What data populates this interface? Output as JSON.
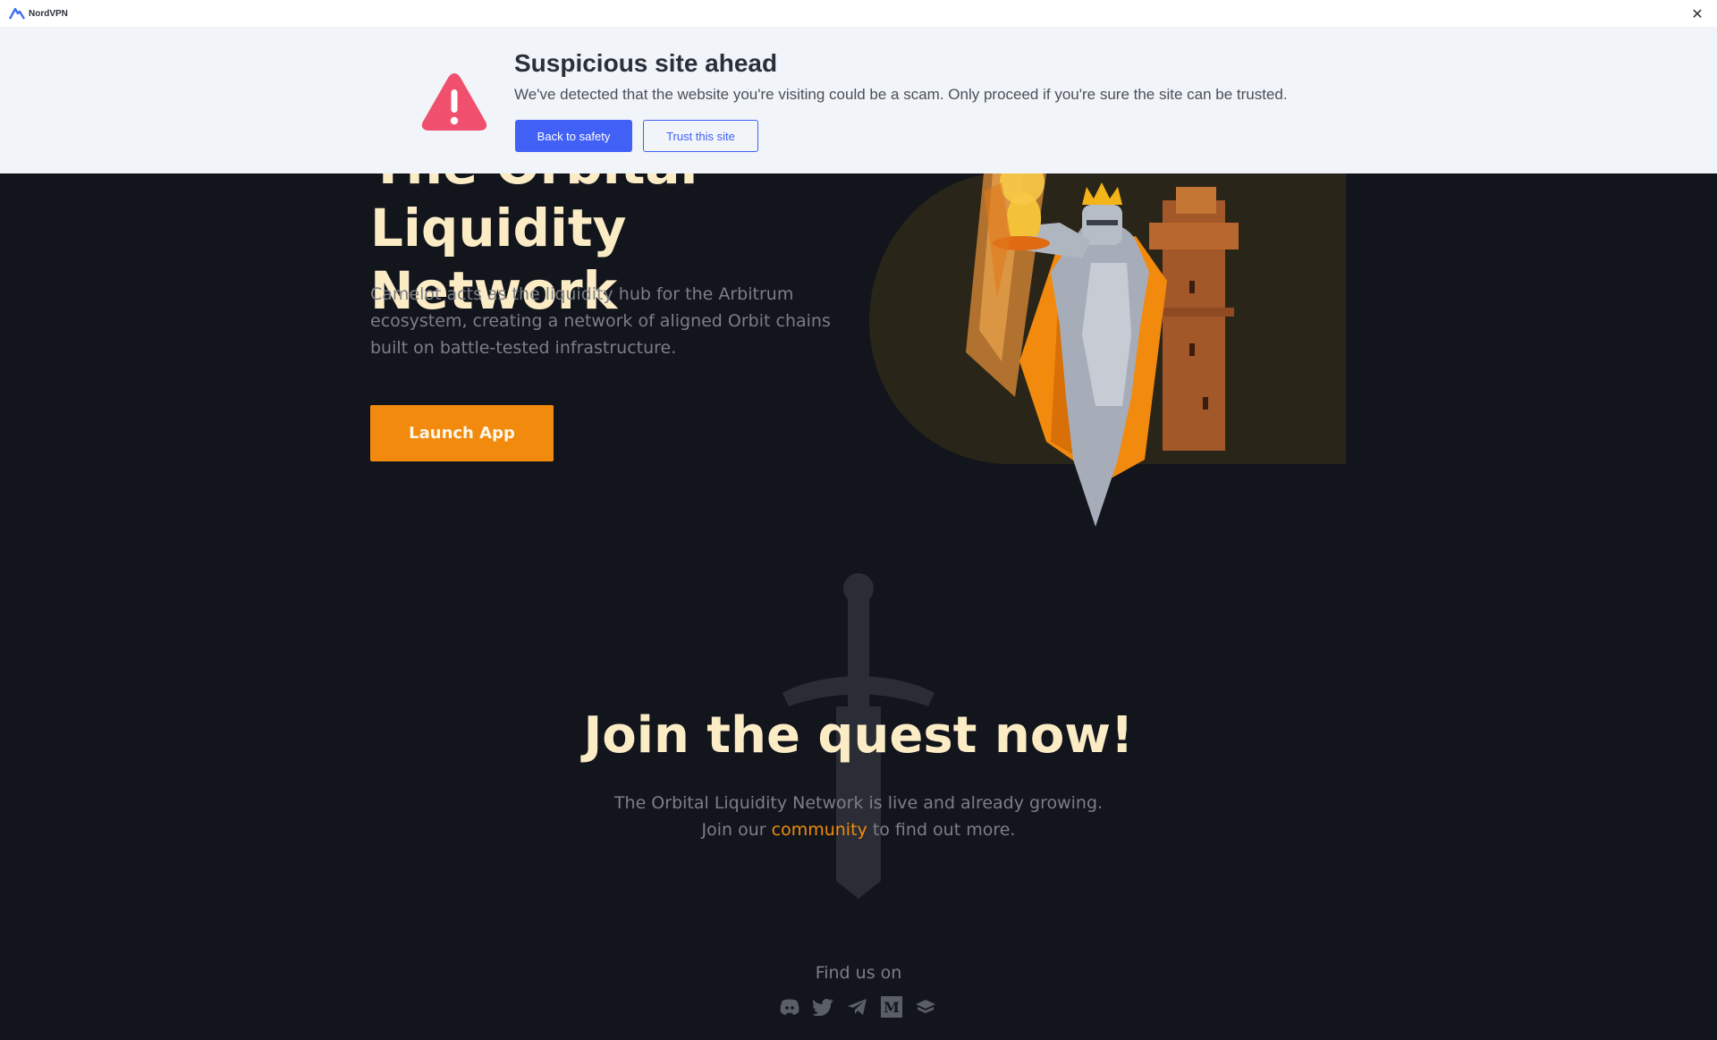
{
  "nordvpn": {
    "brand": "NordVPN",
    "close_glyph": "✕"
  },
  "warning": {
    "title": "Suspicious site ahead",
    "description": "We've detected that the website you're visiting could be a scam. Only proceed if you're sure the site can be trusted.",
    "back_button": "Back to safety",
    "trust_button": "Trust this site",
    "icon": "warning-triangle-icon",
    "accent_color": "#4161f6",
    "alert_color": "#f0506e"
  },
  "hero": {
    "title_line1": "The Orbital",
    "title_line2": "Liquidity Network",
    "description": "Camelot acts as the liquidity hub for the Arbitrum ecosystem, creating a network of aligned Orbit chains built on battle-tested infrastructure.",
    "launch_button": "Launch App",
    "brand_color": "#f28a0d"
  },
  "join": {
    "title": "Join the quest now!",
    "line1": "The Orbital Liquidity Network is live and already growing.",
    "line2_prefix": "Join our ",
    "line2_link": "community",
    "line2_suffix": " to find out more."
  },
  "footer": {
    "find_us": "Find us on",
    "socials": [
      "discord-icon",
      "twitter-icon",
      "telegram-icon",
      "medium-icon",
      "docs-icon"
    ]
  }
}
